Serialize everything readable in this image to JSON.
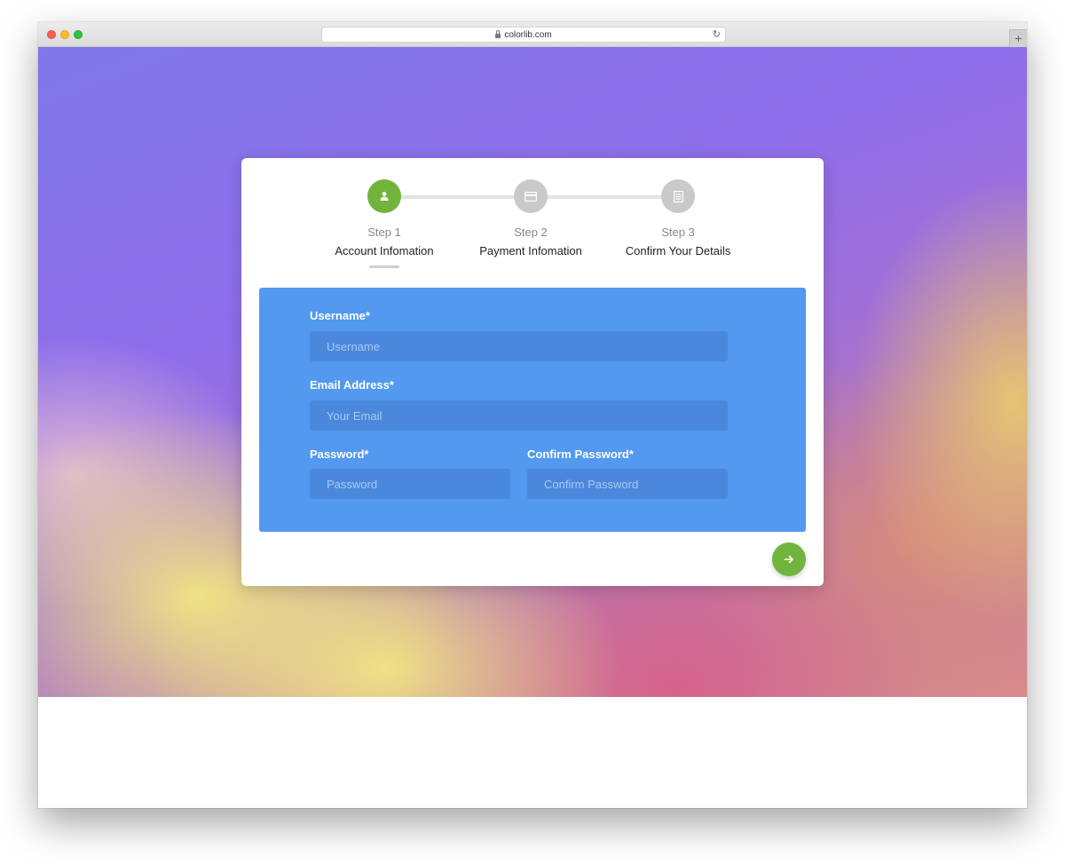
{
  "browser": {
    "url": "colorlib.com",
    "reload_icon": "↻",
    "newtab_icon": "+"
  },
  "steps": [
    {
      "number": "Step 1",
      "title": "Account Infomation",
      "icon": "user-icon",
      "active": true
    },
    {
      "number": "Step 2",
      "title": "Payment Infomation",
      "icon": "credit-card-icon",
      "active": false
    },
    {
      "number": "Step 3",
      "title": "Confirm Your Details",
      "icon": "document-icon",
      "active": false
    }
  ],
  "form": {
    "username": {
      "label": "Username*",
      "placeholder": "Username"
    },
    "email": {
      "label": "Email Address*",
      "placeholder": "Your Email"
    },
    "password": {
      "label": "Password*",
      "placeholder": "Password"
    },
    "confirm_password": {
      "label": "Confirm Password*",
      "placeholder": "Confirm Password"
    }
  },
  "next_button": {
    "icon": "arrow-right-icon"
  },
  "colors": {
    "accent_green": "#71b43b",
    "panel_blue": "#5299ef",
    "input_blue": "#4a88dc",
    "inactive_gray": "#c9c9c9"
  }
}
